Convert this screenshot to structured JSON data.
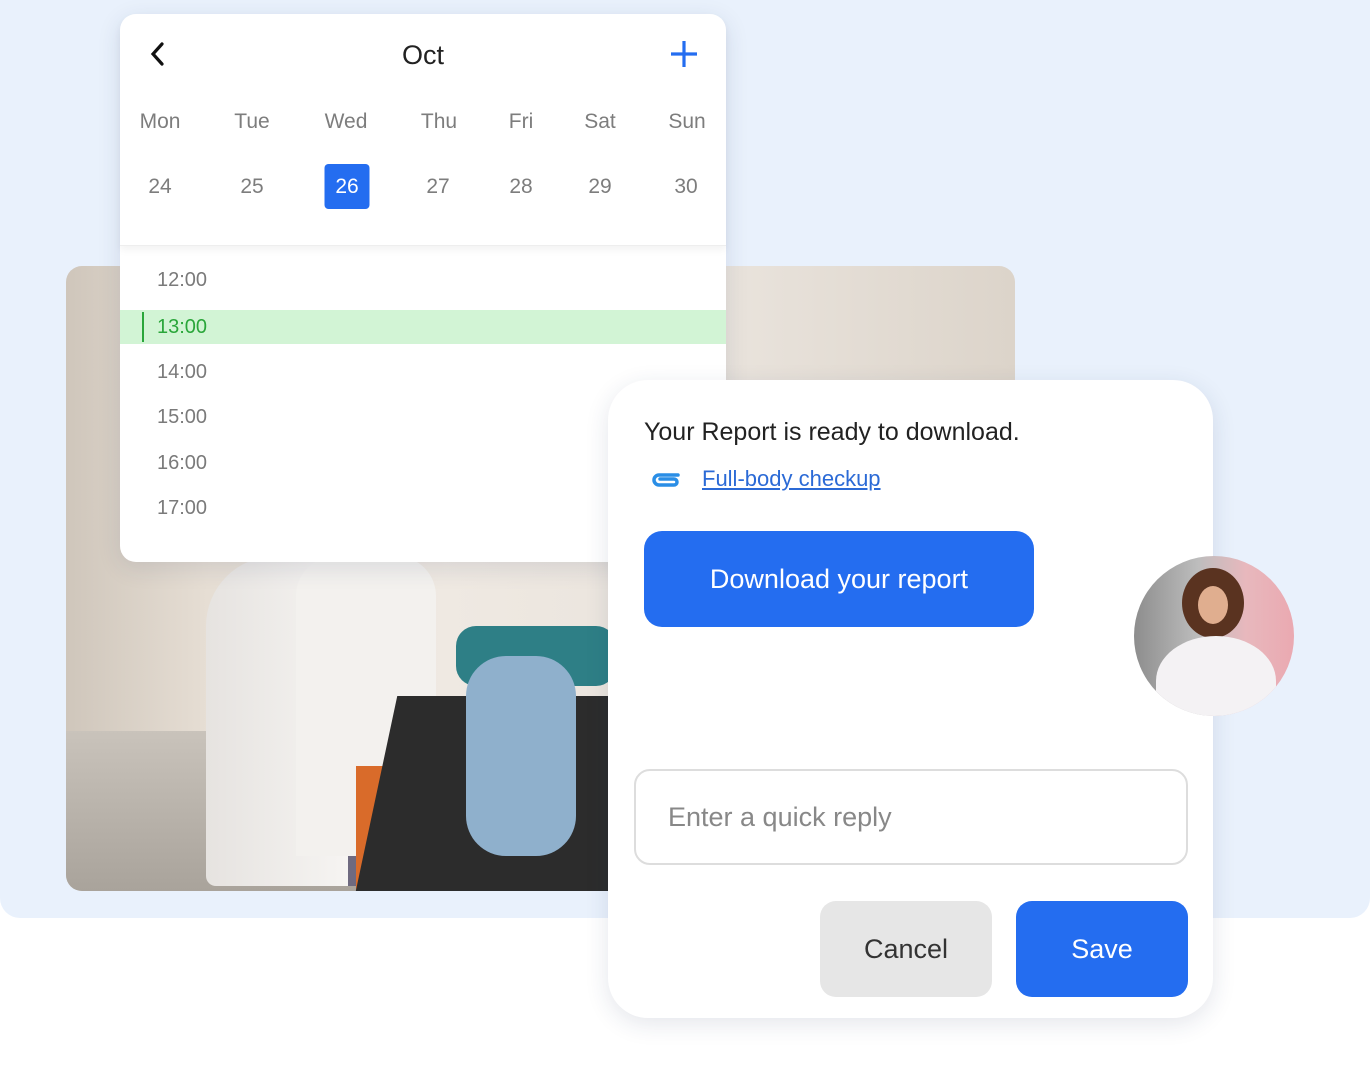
{
  "calendar": {
    "month": "Oct",
    "back_icon": "chevron-left-icon",
    "add_icon": "plus-icon",
    "weekdays": [
      "Mon",
      "Tue",
      "Wed",
      "Thu",
      "Fri",
      "Sat",
      "Sun"
    ],
    "dates": [
      "24",
      "25",
      "26",
      "27",
      "28",
      "29",
      "30"
    ],
    "selected_date": "26",
    "times": [
      "12:00",
      "13:00",
      "14:00",
      "15:00",
      "16:00",
      "17:00"
    ],
    "active_time": "13:00",
    "colors": {
      "accent": "#246df0",
      "active_slot_bg": "#d2f4d5",
      "active_slot_text": "#2aa63a"
    }
  },
  "report": {
    "message": "Your Report is ready to download.",
    "attachment_icon": "paperclip-icon",
    "attachment_link": "Full-body checkup",
    "download_label": "Download your report",
    "reply_placeholder": "Enter a quick reply",
    "reply_value": "",
    "cancel_label": "Cancel",
    "save_label": "Save"
  }
}
